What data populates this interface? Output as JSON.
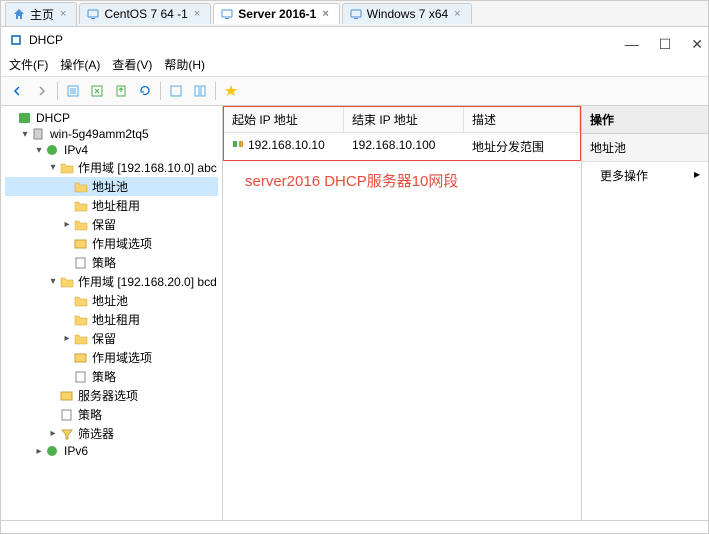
{
  "tabs": [
    {
      "label": "主页",
      "icon": "home"
    },
    {
      "label": "CentOS 7 64 -1",
      "icon": "vm"
    },
    {
      "label": "Server 2016-1",
      "icon": "vm",
      "active": true
    },
    {
      "label": "Windows 7 x64",
      "icon": "vm"
    }
  ],
  "app": {
    "title": "DHCP"
  },
  "menu": {
    "file": "文件(F)",
    "action": "操作(A)",
    "view": "查看(V)",
    "help": "帮助(H)"
  },
  "tree": {
    "root": "DHCP",
    "server": "win-5g49amm2tq5",
    "ipv4": "IPv4",
    "scope1": "作用域 [192.168.10.0] abc",
    "addressPool": "地址池",
    "leases": "地址租用",
    "reservations": "保留",
    "scopeOptions": "作用域选项",
    "policies": "策略",
    "scope2": "作用域 [192.168.20.0] bcd",
    "serverOptions": "服务器选项",
    "filters": "筛选器",
    "ipv6": "IPv6"
  },
  "list": {
    "col1": "起始 IP 地址",
    "col2": "结束 IP 地址",
    "col3": "描述",
    "row1": {
      "start": "192.168.10.10",
      "end": "192.168.10.100",
      "desc": "地址分发范围"
    }
  },
  "annotation": "server2016 DHCP服务器10网段",
  "actions": {
    "header": "操作",
    "sub": "地址池",
    "more": "更多操作"
  }
}
